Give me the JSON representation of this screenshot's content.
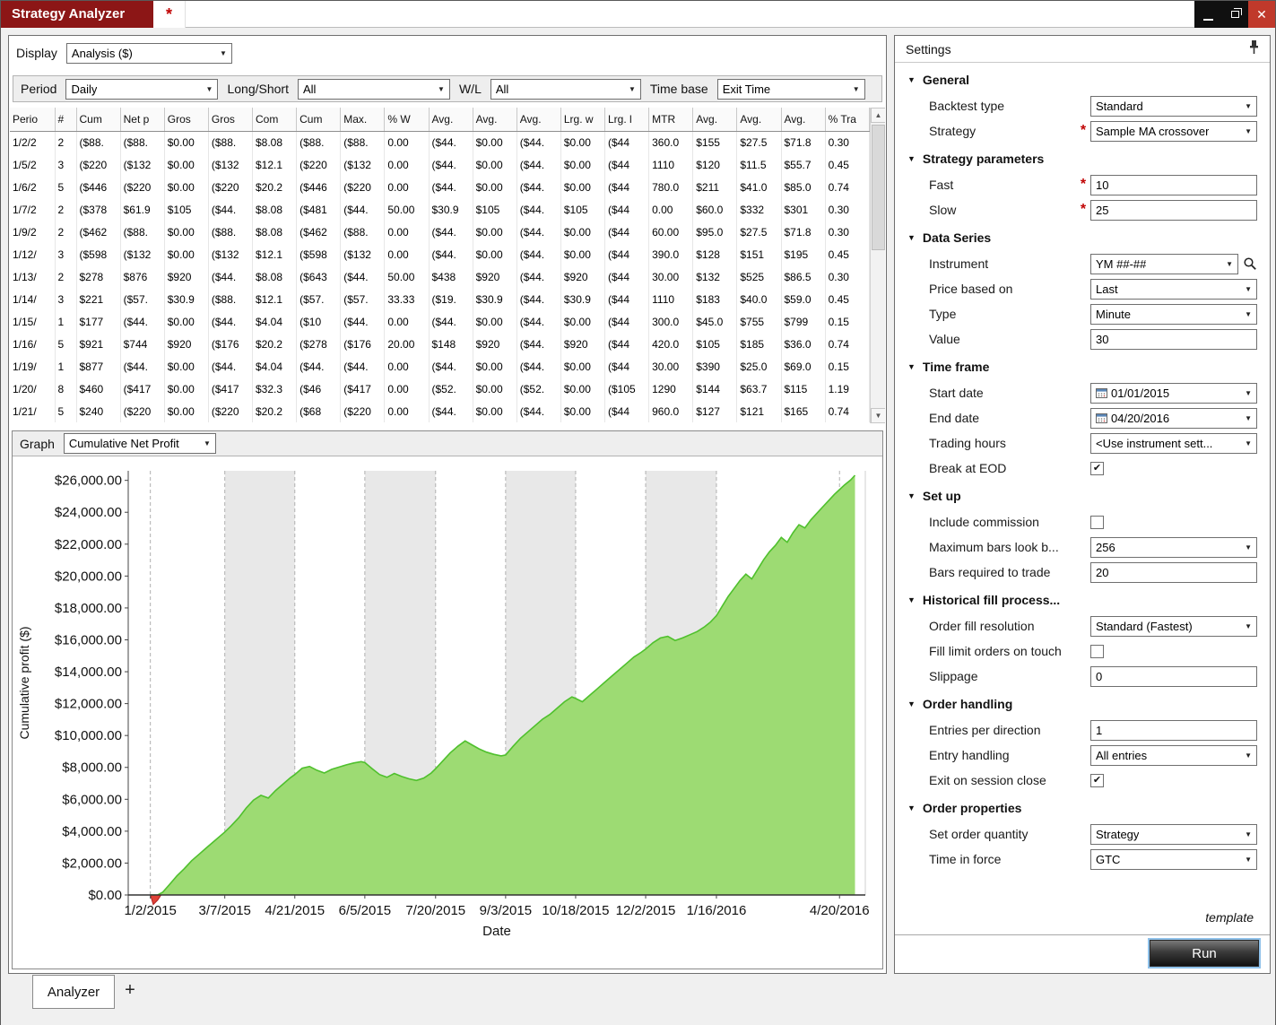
{
  "window": {
    "title": "Strategy Analyzer",
    "dirty_marker": "*"
  },
  "icons": {
    "minimize": "minimize-bar",
    "restore": "restore-squares",
    "close": "✕",
    "pin": "pushpin",
    "search": "magnifier",
    "calendar": "calendar-grid",
    "dropdown_arrow": "▼",
    "section_expanded": "▼",
    "scroll_up": "▲",
    "scroll_down": "▼",
    "check": "✔"
  },
  "display": {
    "label": "Display",
    "value": "Analysis ($)"
  },
  "filters": {
    "period_label": "Period",
    "period_value": "Daily",
    "longshort_label": "Long/Short",
    "longshort_value": "All",
    "wl_label": "W/L",
    "wl_value": "All",
    "timebase_label": "Time base",
    "timebase_value": "Exit Time"
  },
  "graph": {
    "label": "Graph",
    "value": "Cumulative Net Profit"
  },
  "tabs": {
    "analyzer": "Analyzer",
    "add": "+"
  },
  "table": {
    "columns": [
      "Perio",
      "#",
      "Cum",
      "Net p",
      "Gros",
      "Gros",
      "Com",
      "Cum",
      "Max.",
      "% W",
      "Avg.",
      "Avg.",
      "Avg.",
      "Lrg. w",
      "Lrg. l",
      "MTR",
      "Avg.",
      "Avg.",
      "Avg.",
      "% Tra"
    ],
    "rows": [
      [
        "1/2/2",
        "2",
        "($88.",
        "($88.",
        "$0.00",
        "($88.",
        "$8.08",
        "($88.",
        "($88.",
        "0.00",
        "($44.",
        "$0.00",
        "($44.",
        "$0.00",
        "($44",
        "360.0",
        "$155",
        "$27.5",
        "$71.8",
        "0.30"
      ],
      [
        "1/5/2",
        "3",
        "($220",
        "($132",
        "$0.00",
        "($132",
        "$12.1",
        "($220",
        "($132",
        "0.00",
        "($44.",
        "$0.00",
        "($44.",
        "$0.00",
        "($44",
        "1110",
        "$120",
        "$11.5",
        "$55.7",
        "0.45"
      ],
      [
        "1/6/2",
        "5",
        "($446",
        "($220",
        "$0.00",
        "($220",
        "$20.2",
        "($446",
        "($220",
        "0.00",
        "($44.",
        "$0.00",
        "($44.",
        "$0.00",
        "($44",
        "780.0",
        "$211",
        "$41.0",
        "$85.0",
        "0.74"
      ],
      [
        "1/7/2",
        "2",
        "($378",
        "$61.9",
        "$105",
        "($44.",
        "$8.08",
        "($481",
        "($44.",
        "50.00",
        "$30.9",
        "$105",
        "($44.",
        "$105",
        "($44",
        "0.00",
        "$60.0",
        "$332",
        "$301",
        "0.30"
      ],
      [
        "1/9/2",
        "2",
        "($462",
        "($88.",
        "$0.00",
        "($88.",
        "$8.08",
        "($462",
        "($88.",
        "0.00",
        "($44.",
        "$0.00",
        "($44.",
        "$0.00",
        "($44",
        "60.00",
        "$95.0",
        "$27.5",
        "$71.8",
        "0.30"
      ],
      [
        "1/12/",
        "3",
        "($598",
        "($132",
        "$0.00",
        "($132",
        "$12.1",
        "($598",
        "($132",
        "0.00",
        "($44.",
        "$0.00",
        "($44.",
        "$0.00",
        "($44",
        "390.0",
        "$128",
        "$151",
        "$195",
        "0.45"
      ],
      [
        "1/13/",
        "2",
        "$278",
        "$876",
        "$920",
        "($44.",
        "$8.08",
        "($643",
        "($44.",
        "50.00",
        "$438",
        "$920",
        "($44.",
        "$920",
        "($44",
        "30.00",
        "$132",
        "$525",
        "$86.5",
        "0.30"
      ],
      [
        "1/14/",
        "3",
        "$221",
        "($57.",
        "$30.9",
        "($88.",
        "$12.1",
        "($57.",
        "($57.",
        "33.33",
        "($19.",
        "$30.9",
        "($44.",
        "$30.9",
        "($44",
        "1110",
        "$183",
        "$40.0",
        "$59.0",
        "0.45"
      ],
      [
        "1/15/",
        "1",
        "$177",
        "($44.",
        "$0.00",
        "($44.",
        "$4.04",
        "($10",
        "($44.",
        "0.00",
        "($44.",
        "$0.00",
        "($44.",
        "$0.00",
        "($44",
        "300.0",
        "$45.0",
        "$755",
        "$799",
        "0.15"
      ],
      [
        "1/16/",
        "5",
        "$921",
        "$744",
        "$920",
        "($176",
        "$20.2",
        "($278",
        "($176",
        "20.00",
        "$148",
        "$920",
        "($44.",
        "$920",
        "($44",
        "420.0",
        "$105",
        "$185",
        "$36.0",
        "0.74"
      ],
      [
        "1/19/",
        "1",
        "$877",
        "($44.",
        "$0.00",
        "($44.",
        "$4.04",
        "($44.",
        "($44.",
        "0.00",
        "($44.",
        "$0.00",
        "($44.",
        "$0.00",
        "($44",
        "30.00",
        "$390",
        "$25.0",
        "$69.0",
        "0.15"
      ],
      [
        "1/20/",
        "8",
        "$460",
        "($417",
        "$0.00",
        "($417",
        "$32.3",
        "($46",
        "($417",
        "0.00",
        "($52.",
        "$0.00",
        "($52.",
        "$0.00",
        "($105",
        "1290",
        "$144",
        "$63.7",
        "$115",
        "1.19"
      ],
      [
        "1/21/",
        "5",
        "$240",
        "($220",
        "$0.00",
        "($220",
        "$20.2",
        "($68",
        "($220",
        "0.00",
        "($44.",
        "$0.00",
        "($44.",
        "$0.00",
        "($44",
        "960.0",
        "$127",
        "$121",
        "$165",
        "0.74"
      ]
    ]
  },
  "chart_data": {
    "type": "area",
    "title": "",
    "xlabel": "Date",
    "ylabel": "Cumulative profit ($)",
    "ylim": [
      0,
      26000
    ],
    "ytick_step": 2000,
    "ytick_labels": [
      "$0.00",
      "$2,000.00",
      "$4,000.00",
      "$6,000.00",
      "$8,000.00",
      "$10,000.00",
      "$12,000.00",
      "$14,000.00",
      "$16,000.00",
      "$18,000.00",
      "$20,000.00",
      "$22,000.00",
      "$24,000.00",
      "$26,000.00"
    ],
    "xticks": [
      {
        "label": "1/2/2015",
        "f": 0.03
      },
      {
        "label": "3/7/2015",
        "f": 0.131
      },
      {
        "label": "4/21/2015",
        "f": 0.226
      },
      {
        "label": "6/5/2015",
        "f": 0.321
      },
      {
        "label": "7/20/2015",
        "f": 0.417
      },
      {
        "label": "9/3/2015",
        "f": 0.512
      },
      {
        "label": "10/18/2015",
        "f": 0.607
      },
      {
        "label": "12/2/2015",
        "f": 0.702
      },
      {
        "label": "1/16/2016",
        "f": 0.798
      },
      {
        "label": "4/20/2016",
        "f": 0.965
      }
    ],
    "shaded_bands": [
      [
        0.131,
        0.226
      ],
      [
        0.321,
        0.417
      ],
      [
        0.512,
        0.607
      ],
      [
        0.702,
        0.798
      ]
    ],
    "colors": {
      "area_fill": "#9ddb73",
      "area_line": "#4fc02d",
      "negative_fill": "#e04338",
      "negative_line": "#b02020",
      "band": "#e8e8e8"
    },
    "series": [
      {
        "name": "Cumulative Net Profit",
        "points": [
          [
            0.03,
            0
          ],
          [
            0.034,
            -600
          ],
          [
            0.04,
            -320
          ],
          [
            0.047,
            180
          ],
          [
            0.056,
            650
          ],
          [
            0.066,
            1200
          ],
          [
            0.076,
            1650
          ],
          [
            0.086,
            2150
          ],
          [
            0.096,
            2550
          ],
          [
            0.106,
            2950
          ],
          [
            0.116,
            3350
          ],
          [
            0.126,
            3750
          ],
          [
            0.131,
            3950
          ],
          [
            0.14,
            4350
          ],
          [
            0.15,
            4850
          ],
          [
            0.16,
            5450
          ],
          [
            0.17,
            5950
          ],
          [
            0.18,
            6250
          ],
          [
            0.19,
            6080
          ],
          [
            0.2,
            6550
          ],
          [
            0.21,
            6950
          ],
          [
            0.22,
            7350
          ],
          [
            0.226,
            7550
          ],
          [
            0.236,
            7950
          ],
          [
            0.246,
            8060
          ],
          [
            0.256,
            7820
          ],
          [
            0.266,
            7650
          ],
          [
            0.276,
            7880
          ],
          [
            0.286,
            8020
          ],
          [
            0.296,
            8160
          ],
          [
            0.306,
            8280
          ],
          [
            0.316,
            8360
          ],
          [
            0.321,
            8300
          ],
          [
            0.331,
            7920
          ],
          [
            0.341,
            7550
          ],
          [
            0.351,
            7380
          ],
          [
            0.361,
            7620
          ],
          [
            0.371,
            7430
          ],
          [
            0.381,
            7280
          ],
          [
            0.391,
            7180
          ],
          [
            0.401,
            7330
          ],
          [
            0.411,
            7640
          ],
          [
            0.417,
            7920
          ],
          [
            0.427,
            8420
          ],
          [
            0.437,
            8920
          ],
          [
            0.447,
            9320
          ],
          [
            0.457,
            9660
          ],
          [
            0.466,
            9420
          ],
          [
            0.476,
            9160
          ],
          [
            0.486,
            8960
          ],
          [
            0.496,
            8820
          ],
          [
            0.506,
            8720
          ],
          [
            0.512,
            8780
          ],
          [
            0.522,
            9320
          ],
          [
            0.532,
            9820
          ],
          [
            0.542,
            10220
          ],
          [
            0.552,
            10620
          ],
          [
            0.562,
            11020
          ],
          [
            0.572,
            11320
          ],
          [
            0.582,
            11720
          ],
          [
            0.592,
            12120
          ],
          [
            0.602,
            12420
          ],
          [
            0.607,
            12320
          ],
          [
            0.616,
            12120
          ],
          [
            0.626,
            12520
          ],
          [
            0.636,
            12920
          ],
          [
            0.646,
            13320
          ],
          [
            0.656,
            13720
          ],
          [
            0.666,
            14120
          ],
          [
            0.676,
            14520
          ],
          [
            0.686,
            14920
          ],
          [
            0.696,
            15220
          ],
          [
            0.702,
            15420
          ],
          [
            0.712,
            15820
          ],
          [
            0.722,
            16120
          ],
          [
            0.732,
            16220
          ],
          [
            0.742,
            15960
          ],
          [
            0.752,
            16120
          ],
          [
            0.762,
            16320
          ],
          [
            0.772,
            16520
          ],
          [
            0.782,
            16820
          ],
          [
            0.79,
            17120
          ],
          [
            0.798,
            17520
          ],
          [
            0.806,
            18120
          ],
          [
            0.814,
            18720
          ],
          [
            0.822,
            19220
          ],
          [
            0.83,
            19720
          ],
          [
            0.838,
            20120
          ],
          [
            0.846,
            19820
          ],
          [
            0.854,
            20420
          ],
          [
            0.862,
            21020
          ],
          [
            0.87,
            21520
          ],
          [
            0.878,
            21920
          ],
          [
            0.886,
            22420
          ],
          [
            0.894,
            22120
          ],
          [
            0.902,
            22720
          ],
          [
            0.91,
            23220
          ],
          [
            0.918,
            23020
          ],
          [
            0.926,
            23520
          ],
          [
            0.934,
            23920
          ],
          [
            0.942,
            24320
          ],
          [
            0.95,
            24720
          ],
          [
            0.958,
            25120
          ],
          [
            0.965,
            25420
          ],
          [
            0.972,
            25720
          ],
          [
            0.98,
            26020
          ],
          [
            0.986,
            26320
          ]
        ]
      }
    ]
  },
  "settings": {
    "title": "Settings",
    "template_label": "template",
    "run_label": "Run",
    "sections": [
      {
        "title": "General",
        "rows": [
          {
            "label": "Backtest type",
            "control": {
              "type": "select",
              "value": "Standard"
            }
          },
          {
            "label": "Strategy",
            "required": true,
            "control": {
              "type": "select",
              "value": "Sample MA crossover"
            }
          }
        ]
      },
      {
        "title": "Strategy parameters",
        "rows": [
          {
            "label": "Fast",
            "required": true,
            "control": {
              "type": "input",
              "value": "10"
            }
          },
          {
            "label": "Slow",
            "required": true,
            "control": {
              "type": "input",
              "value": "25"
            }
          }
        ]
      },
      {
        "title": "Data Series",
        "rows": [
          {
            "label": "Instrument",
            "control": {
              "type": "instrument",
              "value": "YM ##-##"
            }
          },
          {
            "label": "Price based on",
            "control": {
              "type": "select",
              "value": "Last"
            }
          },
          {
            "label": "Type",
            "control": {
              "type": "select",
              "value": "Minute"
            }
          },
          {
            "label": "Value",
            "control": {
              "type": "input",
              "value": "30"
            }
          }
        ]
      },
      {
        "title": "Time frame",
        "rows": [
          {
            "label": "Start date",
            "control": {
              "type": "date",
              "value": "01/01/2015"
            }
          },
          {
            "label": "End date",
            "control": {
              "type": "date",
              "value": "04/20/2016"
            }
          },
          {
            "label": "Trading hours",
            "control": {
              "type": "select",
              "value": "<Use instrument sett..."
            }
          },
          {
            "label": "Break at EOD",
            "control": {
              "type": "checkbox",
              "checked": true
            }
          }
        ]
      },
      {
        "title": "Set up",
        "rows": [
          {
            "label": "Include commission",
            "control": {
              "type": "checkbox",
              "checked": false
            }
          },
          {
            "label": "Maximum bars look b...",
            "control": {
              "type": "select",
              "value": "256"
            }
          },
          {
            "label": "Bars required to trade",
            "control": {
              "type": "input",
              "value": "20"
            }
          }
        ]
      },
      {
        "title": "Historical fill process...",
        "rows": [
          {
            "label": "Order fill resolution",
            "control": {
              "type": "select",
              "value": "Standard (Fastest)"
            }
          },
          {
            "label": "Fill limit orders on touch",
            "control": {
              "type": "checkbox",
              "checked": false
            }
          },
          {
            "label": "Slippage",
            "control": {
              "type": "input",
              "value": "0"
            }
          }
        ]
      },
      {
        "title": "Order handling",
        "rows": [
          {
            "label": "Entries per direction",
            "control": {
              "type": "input",
              "value": "1"
            }
          },
          {
            "label": "Entry handling",
            "control": {
              "type": "select",
              "value": "All entries"
            }
          },
          {
            "label": "Exit on session close",
            "control": {
              "type": "checkbox",
              "checked": true
            }
          }
        ]
      },
      {
        "title": "Order properties",
        "rows": [
          {
            "label": "Set order quantity",
            "control": {
              "type": "select",
              "value": "Strategy"
            }
          },
          {
            "label": "Time in force",
            "control": {
              "type": "select",
              "value": "GTC"
            }
          }
        ]
      }
    ]
  }
}
